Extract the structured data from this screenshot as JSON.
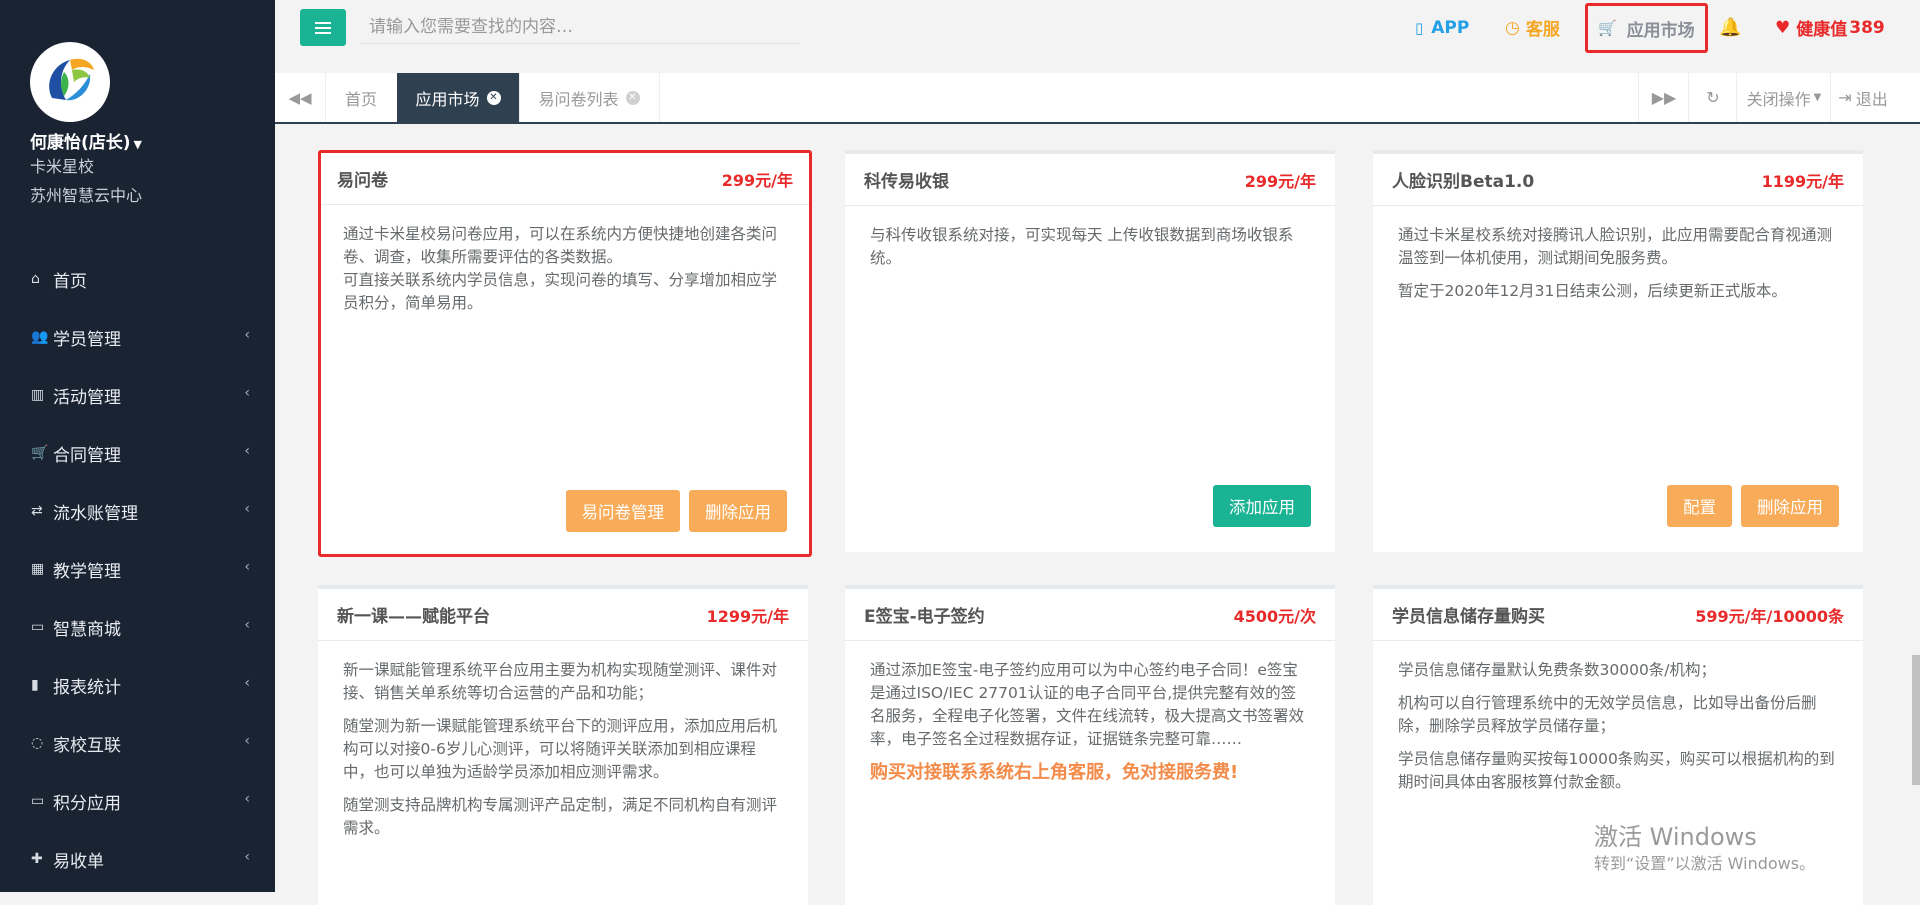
{
  "sidebar": {
    "user_name": "何康怡(店长)",
    "school": "卡米星校",
    "center": "苏州智慧云中心",
    "items": [
      {
        "icon": "home-icon",
        "glyph": "⌂",
        "label": "首页",
        "has_chevron": false
      },
      {
        "icon": "users-icon",
        "glyph": "👥",
        "label": "学员管理",
        "has_chevron": true
      },
      {
        "icon": "map-icon",
        "glyph": "▥",
        "label": "活动管理",
        "has_chevron": true
      },
      {
        "icon": "cart-icon",
        "glyph": "🛒",
        "label": "合同管理",
        "has_chevron": true
      },
      {
        "icon": "refresh-icon",
        "glyph": "⇄",
        "label": "流水账管理",
        "has_chevron": true
      },
      {
        "icon": "calendar-icon",
        "glyph": "▦",
        "label": "教学管理",
        "has_chevron": true
      },
      {
        "icon": "hdd-icon",
        "glyph": "▭",
        "label": "智慧商城",
        "has_chevron": true
      },
      {
        "icon": "bar-chart-icon",
        "glyph": "▮",
        "label": "报表统计",
        "has_chevron": true
      },
      {
        "icon": "comments-icon",
        "glyph": "◌",
        "label": "家校互联",
        "has_chevron": true
      },
      {
        "icon": "hdd-icon",
        "glyph": "▭",
        "label": "积分应用",
        "has_chevron": true
      },
      {
        "icon": "user-plus-icon",
        "glyph": "✚",
        "label": "易收单",
        "has_chevron": true
      }
    ]
  },
  "topbar": {
    "search_placeholder": "请输入您需要查找的内容…",
    "app_label": "APP",
    "kefu_label": "客服",
    "market_label": "应用市场",
    "health_label": "健康值",
    "health_value": "389"
  },
  "tabs": {
    "items": [
      {
        "label": "首页",
        "active": false,
        "closable": false
      },
      {
        "label": "应用市场",
        "active": true,
        "closable": true
      },
      {
        "label": "易问卷列表",
        "active": false,
        "closable": true
      }
    ],
    "close_ops_label": "关闭操作",
    "logout_label": "退出"
  },
  "cards": [
    {
      "title": "易问卷",
      "price": "299元/年",
      "highlighted": true,
      "paragraphs": [
        "通过卡米星校易问卷应用，可以在系统内方便快捷地创建各类问卷、调查，收集所需要评估的各类数据。",
        "可直接关联系统内学员信息，实现问卷的填写、分享增加相应学员积分，简单易用。"
      ],
      "buttons": [
        {
          "label": "易问卷管理",
          "style": "orange"
        },
        {
          "label": "删除应用",
          "style": "orange"
        }
      ]
    },
    {
      "title": "科传易收银",
      "price": "299元/年",
      "highlighted": false,
      "paragraphs": [
        "与科传收银系统对接，可实现每天 上传收银数据到商场收银系统。"
      ],
      "buttons": [
        {
          "label": "添加应用",
          "style": "green"
        }
      ]
    },
    {
      "title": "人脸识别Beta1.0",
      "price": "1199元/年",
      "highlighted": false,
      "paragraphs": [
        "通过卡米星校系统对接腾讯人脸识别，此应用需要配合育视通测温签到一体机使用，测试期间免服务费。",
        "暂定于2020年12月31日结束公测，后续更新正式版本。"
      ],
      "buttons": [
        {
          "label": "配置",
          "style": "orange"
        },
        {
          "label": "删除应用",
          "style": "orange"
        }
      ]
    },
    {
      "title": "新一课——赋能平台",
      "price": "1299元/年",
      "highlighted": false,
      "paragraphs": [
        "新一课赋能管理系统平台应用主要为机构实现随堂测评、课件对接、销售关单系统等切合运营的产品和功能；",
        "随堂测为新一课赋能管理系统平台下的测评应用，添加应用后机构可以对接0-6岁儿心测评，可以将随评关联添加到相应课程中，也可以单独为适龄学员添加相应测评需求。",
        "随堂测支持品牌机构专属测评产品定制，满足不同机构自有测评需求。"
      ],
      "buttons": []
    },
    {
      "title": "E签宝-电子签约",
      "price": "4500元/次",
      "highlighted": false,
      "paragraphs": [
        "通过添加E签宝-电子签约应用可以为中心签约电子合同！e签宝是通过ISO/IEC 27701认证的电子合同平台,提供完整有效的签名服务，全程电子化签署，文件在线流转，极大提高文书签署效率，电子签名全过程数据存证，证据链条完整可靠……"
      ],
      "promo": "购买对接联系系统右上角客服，免对接服务费!",
      "buttons": []
    },
    {
      "title": "学员信息储存量购买",
      "price": "599元/年/10000条",
      "highlighted": false,
      "paragraphs": [
        "学员信息储存量默认免费条数30000条/机构；",
        "机构可以自行管理系统中的无效学员信息，比如导出备份后删除，删除学员释放学员储存量；",
        "学员信息储存量购买按每10000条购买，购买可以根据机构的到期时间具体由客服核算付款金额。"
      ],
      "buttons": []
    }
  ],
  "watermark": {
    "line1": "激活 Windows",
    "line2": "转到“设置”以激活 Windows。"
  }
}
